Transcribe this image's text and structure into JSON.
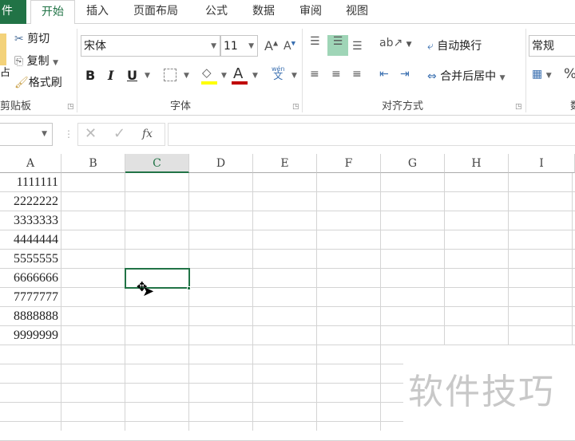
{
  "tabs": [
    "件",
    "开始",
    "插入",
    "页面布局",
    "公式",
    "数据",
    "审阅",
    "视图"
  ],
  "active_tab": "开始",
  "clipboard": {
    "paste_partial": "占",
    "cut": "剪切",
    "copy": "复制",
    "format_painter": "格式刷",
    "label": "剪贴板"
  },
  "font": {
    "name": "宋体",
    "size": "11",
    "label": "字体",
    "bold": "B",
    "italic": "I",
    "underline": "U",
    "font_color": "A",
    "phonetic_top": "wén",
    "phonetic_bottom": "文",
    "fill_color": "#ffff00",
    "text_color": "#c00000"
  },
  "alignment": {
    "wrap_text": "自动换行",
    "merge_center": "合并后居中",
    "label": "对齐方式"
  },
  "number": {
    "format": "常规",
    "label_partial": "数",
    "percent": "%"
  },
  "formula_bar": {
    "name_box": "",
    "cancel": "✕",
    "enter": "✓",
    "fx": "fx",
    "formula": ""
  },
  "columns": [
    "A",
    "B",
    "C",
    "D",
    "E",
    "F",
    "G",
    "H",
    "I"
  ],
  "selected_column": "C",
  "selected_cell": "C6",
  "cells_A": [
    "1111111",
    "2222222",
    "3333333",
    "4444444",
    "5555555",
    "6666666",
    "7777777",
    "8888888",
    "9999999"
  ],
  "watermark": "软件技巧",
  "accent": "#217346"
}
